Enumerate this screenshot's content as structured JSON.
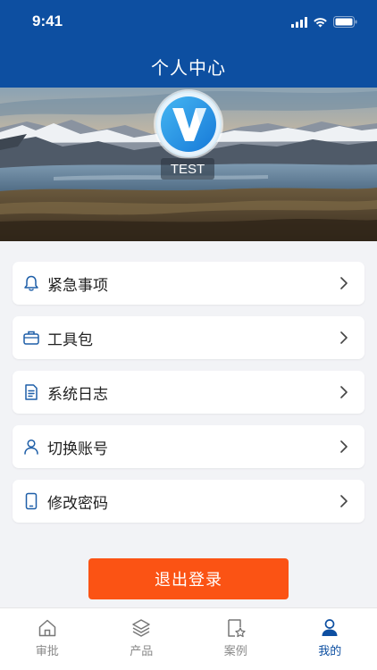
{
  "status_bar": {
    "time": "9:41"
  },
  "nav": {
    "title": "个人中心"
  },
  "profile": {
    "avatar_letter": "V",
    "username": "TEST"
  },
  "menu": {
    "items": [
      {
        "label": "紧急事项",
        "icon": "bell-icon"
      },
      {
        "label": "工具包",
        "icon": "briefcase-icon"
      },
      {
        "label": "系统日志",
        "icon": "document-icon"
      },
      {
        "label": "切换账号",
        "icon": "user-icon"
      },
      {
        "label": "修改密码",
        "icon": "phone-icon"
      }
    ]
  },
  "logout": {
    "label": "退出登录"
  },
  "tabs": [
    {
      "label": "审批",
      "icon": "home-icon",
      "active": false
    },
    {
      "label": "产品",
      "icon": "layers-icon",
      "active": false
    },
    {
      "label": "案例",
      "icon": "star-document-icon",
      "active": false
    },
    {
      "label": "我的",
      "icon": "user-icon",
      "active": true
    }
  ],
  "colors": {
    "brand_blue": "#0d4fa1",
    "logout_orange": "#fb5314",
    "icon_blue": "#1f5fa8"
  }
}
